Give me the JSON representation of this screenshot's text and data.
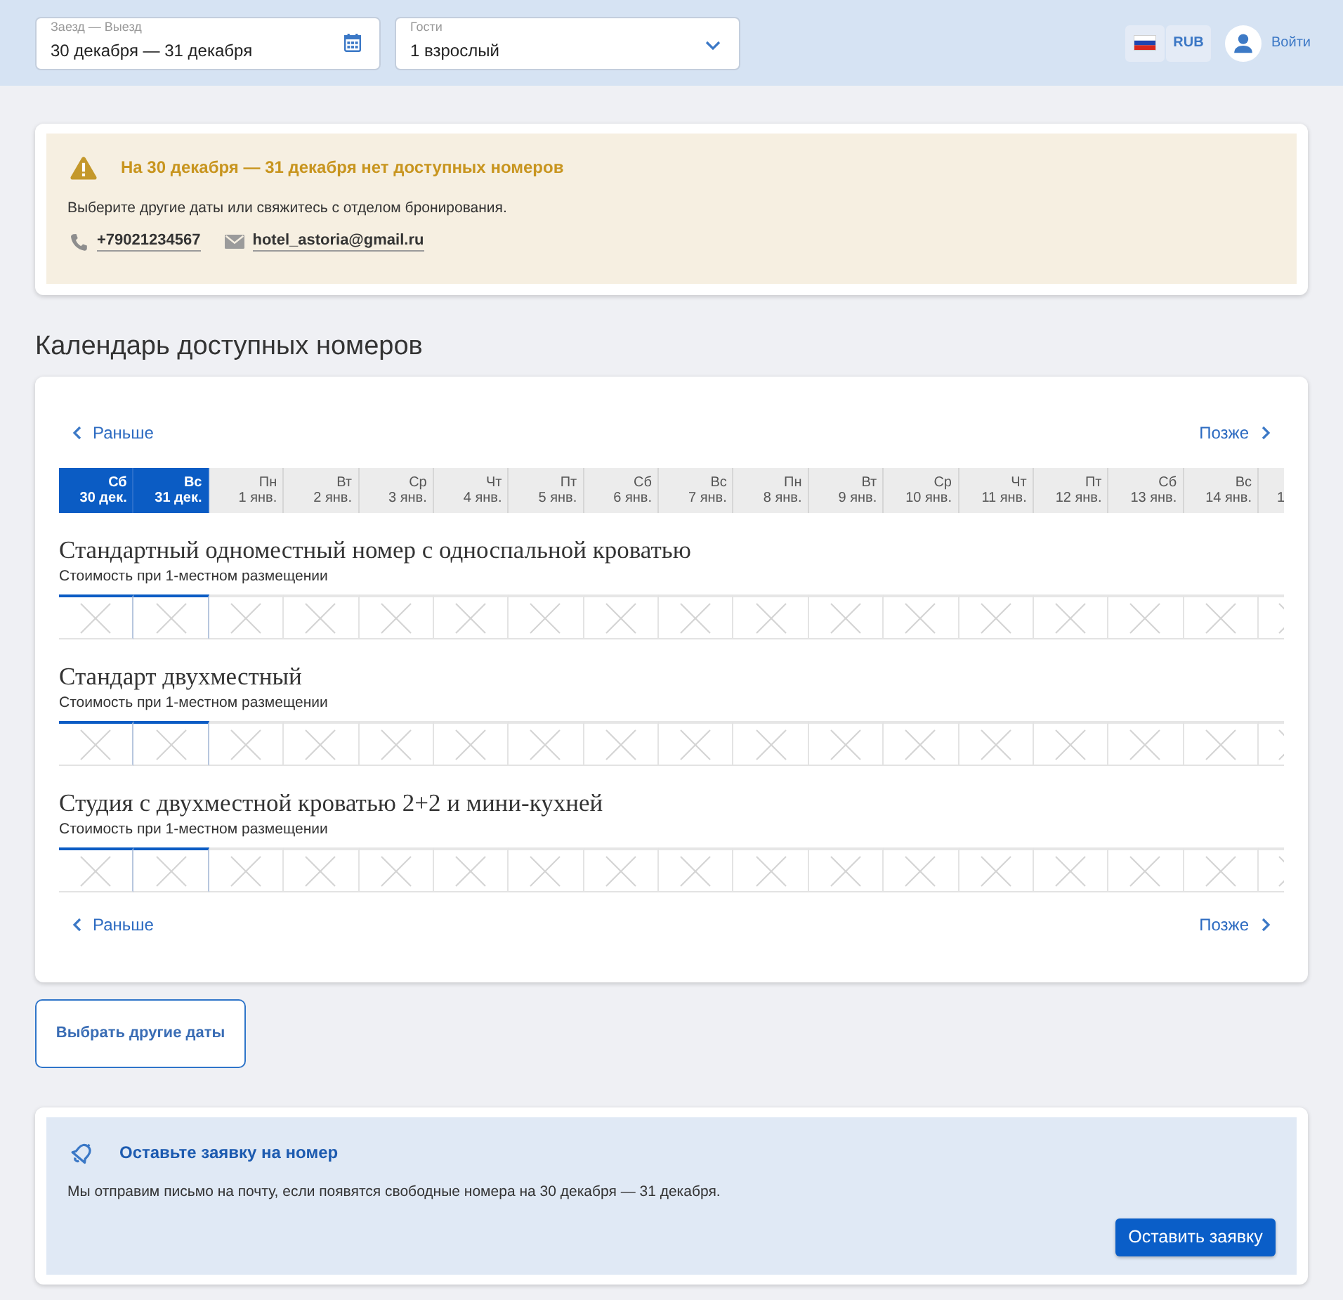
{
  "header": {
    "dates_field": {
      "label": "Заезд — Выезд",
      "value": "30 декабря — 31 декабря"
    },
    "guests_field": {
      "label": "Гости",
      "value": "1 взрослый"
    },
    "currency": "RUB",
    "login": "Войти"
  },
  "alert": {
    "title": "На 30 декабря — 31 декабря нет доступных номеров",
    "text": "Выберите другие даты или свяжитесь с отделом бронирования.",
    "contacts": [
      {
        "kind": "phone",
        "text": "+79021234567"
      },
      {
        "kind": "email",
        "text": "hotel_astoria@gmail.ru"
      }
    ]
  },
  "calendar": {
    "title": "Календарь доступных номеров",
    "nav_top": {
      "prev": "Раньше",
      "next": "Позже"
    },
    "dates": [
      {
        "weekday": "Сб",
        "date": "30 дек.",
        "selected": true
      },
      {
        "weekday": "Вс",
        "date": "31 дек.",
        "selected": true
      },
      {
        "weekday": "Пн",
        "date": "1 янв.",
        "selected": false
      },
      {
        "weekday": "Вт",
        "date": "2 янв.",
        "selected": false
      },
      {
        "weekday": "Ср",
        "date": "3 янв.",
        "selected": false
      },
      {
        "weekday": "Чт",
        "date": "4 янв.",
        "selected": false
      },
      {
        "weekday": "Пт",
        "date": "5 янв.",
        "selected": false
      },
      {
        "weekday": "Сб",
        "date": "6 янв.",
        "selected": false
      },
      {
        "weekday": "Вс",
        "date": "7 янв.",
        "selected": false
      },
      {
        "weekday": "Пн",
        "date": "8 янв.",
        "selected": false
      },
      {
        "weekday": "Вт",
        "date": "9 янв.",
        "selected": false
      },
      {
        "weekday": "Ср",
        "date": "10 янв.",
        "selected": false
      },
      {
        "weekday": "Чт",
        "date": "11 янв.",
        "selected": false
      },
      {
        "weekday": "Пт",
        "date": "12 янв.",
        "selected": false
      },
      {
        "weekday": "Сб",
        "date": "13 янв.",
        "selected": false
      },
      {
        "weekday": "Вс",
        "date": "14 янв.",
        "selected": false
      },
      {
        "date": "1",
        "selected": false
      }
    ],
    "rooms": [
      {
        "title": "Стандартный одноместный номер с односпальной кроватью",
        "subtitle": "Стоимость при 1-местном размещении",
        "cells": [
          {
            "available": false
          },
          {
            "available": false
          },
          {
            "available": false
          },
          {
            "available": false
          },
          {
            "available": false
          },
          {
            "available": false
          },
          {
            "available": false
          },
          {
            "available": false
          },
          {
            "available": false
          },
          {
            "available": false
          },
          {
            "available": false
          },
          {
            "available": false
          },
          {
            "available": false
          },
          {
            "available": false
          },
          {
            "available": false
          },
          {
            "available": false
          },
          {
            "available": false
          }
        ]
      },
      {
        "title": "Стандарт двухместный",
        "subtitle": "Стоимость при 1-местном размещении",
        "cells": [
          {
            "available": false
          },
          {
            "available": false
          },
          {
            "available": false
          },
          {
            "available": false
          },
          {
            "available": false
          },
          {
            "available": false
          },
          {
            "available": false
          },
          {
            "available": false
          },
          {
            "available": false
          },
          {
            "available": false
          },
          {
            "available": false
          },
          {
            "available": false
          },
          {
            "available": false
          },
          {
            "available": false
          },
          {
            "available": false
          },
          {
            "available": false
          },
          {
            "available": false
          }
        ]
      },
      {
        "title": "Студия с двухместной кроватью 2+2 и мини-кухней",
        "subtitle": "Стоимость при 1-местном размещении",
        "cells": [
          {
            "available": false
          },
          {
            "available": false
          },
          {
            "available": false
          },
          {
            "available": false
          },
          {
            "available": false
          },
          {
            "available": false
          },
          {
            "available": false
          },
          {
            "available": false
          },
          {
            "available": false
          },
          {
            "available": false
          },
          {
            "available": false
          },
          {
            "available": false
          },
          {
            "available": false
          },
          {
            "available": false
          },
          {
            "available": false
          },
          {
            "available": false
          },
          {
            "available": false
          }
        ]
      }
    ],
    "nav_bottom": {
      "prev": "Раньше",
      "next": "Позже"
    }
  },
  "change_dates_button": "Выбрать другие даты",
  "request": {
    "title": "Оставьте заявку на номер",
    "text": "Мы отправим письмо на почту, если появятся свободные номера на 30 декабря — 31 декабря.",
    "button": "Оставить заявку"
  }
}
